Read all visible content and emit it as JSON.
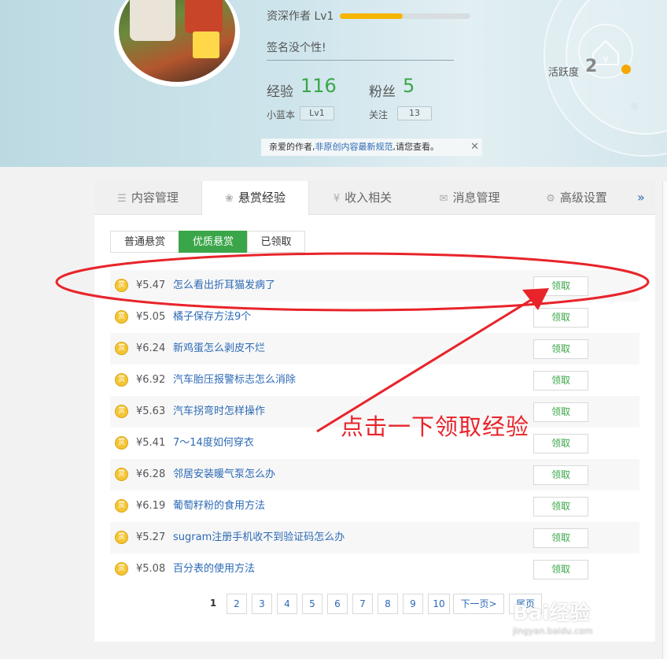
{
  "header": {
    "level_text": "资深作者 Lv1",
    "level_progress": 0.48,
    "signature": "签名没个性!",
    "exp_label": "经验",
    "exp_value": "116",
    "fans_label": "粉丝",
    "fans_value": "5",
    "badge_label": "小蓝本",
    "badge_level": "Lv1",
    "follow_label": "关注",
    "follow_value": "13",
    "activity_label": "活跃度",
    "activity_value": "2",
    "notice_prefix": "亲爱的作者,",
    "notice_link": "非原创内容最新规范",
    "notice_suffix": ",请您查看。",
    "notice_close": "✕"
  },
  "tabs": [
    {
      "label": "内容管理",
      "icon": "list-icon",
      "glyph": "☰"
    },
    {
      "label": "悬赏经验",
      "icon": "reward-icon",
      "glyph": "❀"
    },
    {
      "label": "收入相关",
      "icon": "yen-icon",
      "glyph": "¥"
    },
    {
      "label": "消息管理",
      "icon": "mail-icon",
      "glyph": "✉"
    },
    {
      "label": "高级设置",
      "icon": "gear-icon",
      "glyph": "⚙"
    }
  ],
  "more_icon": "»",
  "subtabs": [
    "普通悬赏",
    "优质悬赏",
    "已领取"
  ],
  "coin_glyph": "赏",
  "claim_label": "领取",
  "rewards": [
    {
      "price": "¥5.47",
      "title": "怎么看出折耳猫发病了"
    },
    {
      "price": "¥5.05",
      "title": "橘子保存方法9个"
    },
    {
      "price": "¥6.24",
      "title": "新鸡蛋怎么剥皮不烂"
    },
    {
      "price": "¥6.92",
      "title": "汽车胎压报警标志怎么消除"
    },
    {
      "price": "¥5.63",
      "title": "汽车拐弯时怎样操作"
    },
    {
      "price": "¥5.41",
      "title": "7～14度如何穿衣"
    },
    {
      "price": "¥6.28",
      "title": "邻居安装暖气泵怎么办"
    },
    {
      "price": "¥6.19",
      "title": "葡萄籽粉的食用方法"
    },
    {
      "price": "¥5.27",
      "title": "sugram注册手机收不到验证码怎么办"
    },
    {
      "price": "¥5.08",
      "title": "百分表的使用方法"
    }
  ],
  "pager": {
    "current": "1",
    "pages": [
      "2",
      "3",
      "4",
      "5",
      "6",
      "7",
      "8",
      "9",
      "10"
    ],
    "next": "下一页>",
    "last": "尾页"
  },
  "annotation": "点击一下领取经验",
  "watermark": {
    "brand": "Bai经验",
    "url": "jingyan.baidu.com"
  },
  "colors": {
    "accent_green": "#3aa649",
    "link_blue": "#2c6ab5",
    "annotation_red": "#e8242a",
    "level_bar": "#f5b500"
  }
}
